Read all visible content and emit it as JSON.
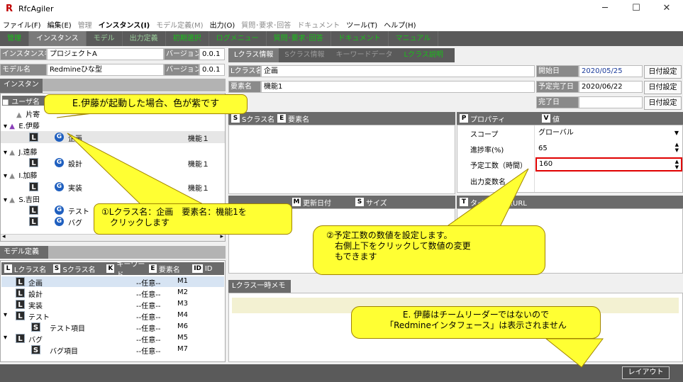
{
  "window": {
    "title": "RfcAgiler",
    "min": "─",
    "max": "☐",
    "close": "✕"
  },
  "menu": [
    {
      "label": "ファイル(F)",
      "dim": false,
      "bold": false
    },
    {
      "label": "編集(E)",
      "dim": false,
      "bold": false
    },
    {
      "label": "管理",
      "dim": true,
      "bold": false
    },
    {
      "label": "インスタンス(I)",
      "dim": false,
      "bold": true
    },
    {
      "label": "モデル定義(M)",
      "dim": true,
      "bold": false
    },
    {
      "label": "出力(O)",
      "dim": false,
      "bold": false
    },
    {
      "label": "質問･要求･回答",
      "dim": true,
      "bold": false
    },
    {
      "label": "ドキュメント",
      "dim": true,
      "bold": false
    },
    {
      "label": "ツール(T)",
      "dim": false,
      "bold": false
    },
    {
      "label": "ヘルプ(H)",
      "dim": false,
      "bold": false
    }
  ],
  "tabs": [
    {
      "label": "管理",
      "cls": "green"
    },
    {
      "label": "インスタンス",
      "cls": "active"
    },
    {
      "label": "モデル",
      "cls": ""
    },
    {
      "label": "出力定義",
      "cls": ""
    },
    {
      "label": "初期選択",
      "cls": "green"
    },
    {
      "label": "ログメニュー",
      "cls": "green"
    },
    {
      "label": "質問･要求･回答",
      "cls": "green"
    },
    {
      "label": "ドキュメント",
      "cls": "green"
    },
    {
      "label": "マニュアル",
      "cls": "green"
    }
  ],
  "instance": {
    "name_label": "インスタンス名",
    "name": "プロジェクトA",
    "version_label": "バージョン",
    "version": "0.0.1",
    "model_label": "モデル名",
    "model": "Redmineひな型",
    "model_version": "0.0.1"
  },
  "instance_panel": {
    "title": "インスタンス",
    "col_user": "ユーザ名"
  },
  "tree": {
    "u0": "片寄",
    "u1": "E.伊藤",
    "u1_L": "L",
    "u1_G": "G",
    "u1_item": "企画",
    "u1_val": "機能１",
    "u2": "J.遠藤",
    "u2_item": "設計",
    "u2_val": "機能１",
    "u3": "I.加藤",
    "u3_item": "実装",
    "u3_val": "機能１",
    "u4": "S.吉田",
    "u4_item1": "テスト",
    "u4_item2": "バグ"
  },
  "model_panel": {
    "title": "モデル定義",
    "cols": [
      "Lクラス名",
      "Sクラス名",
      "キーワード",
      "要素名",
      "ID"
    ],
    "col_badges": [
      "L",
      "S",
      "K",
      "E",
      "ID"
    ],
    "rows": [
      {
        "name": "企画",
        "kw": "--任意--",
        "id": "M1"
      },
      {
        "name": "設計",
        "kw": "--任意--",
        "id": "M2"
      },
      {
        "name": "実装",
        "kw": "--任意--",
        "id": "M3"
      },
      {
        "name": "テスト",
        "kw": "--任意--",
        "id": "M4"
      },
      {
        "name": "テスト項目",
        "kw": "--任意--",
        "id": "M6"
      },
      {
        "name": "バグ",
        "kw": "--任意--",
        "id": "M5"
      },
      {
        "name": "バグ項目",
        "kw": "--任意--",
        "id": "M7"
      }
    ]
  },
  "detail_tabs": [
    "Lクラス情報",
    "Sクラス情報",
    "キーワードデータ",
    "Lクラス説明"
  ],
  "detail": {
    "lclass_label": "Lクラス名",
    "lclass": "企画",
    "elem_label": "要素名",
    "elem": "機能1",
    "start_label": "開始日",
    "start": "2020/05/25",
    "due_label": "予定完了日",
    "due": "2020/06/22",
    "done_label": "完了日",
    "done": "",
    "date_btn": "日付設定"
  },
  "sclass_header": {
    "s": "Sクラス名",
    "e": "要素名"
  },
  "props": {
    "h_prop": "プロパティ",
    "h_val": "値",
    "rows": [
      {
        "k": "スコープ",
        "v": "グローバル"
      },
      {
        "k": "進捗率(%)",
        "v": "65"
      },
      {
        "k": "予定工数（時間）",
        "v": "160"
      },
      {
        "k": "出力変数名",
        "v": ""
      }
    ]
  },
  "file_header": {
    "m": "更新日付",
    "s": "サイズ"
  },
  "url_header": {
    "t": "タイトル",
    "url": "参照URL"
  },
  "memo": {
    "tab": "Lクラス一時メモ"
  },
  "bottom": {
    "layout_btn": "レイアウト"
  },
  "callouts": {
    "c1": "E.伊藤が起動した場合、色が紫です",
    "c2a": "①Lクラス名：企画　要素名：機能1を",
    "c2b": "クリックします",
    "c3a": "②予定工数の数値を設定します。",
    "c3b": "右側上下をクリックして数値の変更",
    "c3c": "もできます",
    "c4a": "E. 伊藤はチームリーダーではないので",
    "c4b": "「Redmineインタフェース」は表示されません"
  },
  "colors": {
    "accent_green": "#18c018",
    "highlight_red": "#e00000",
    "callout": "#ffff33"
  }
}
